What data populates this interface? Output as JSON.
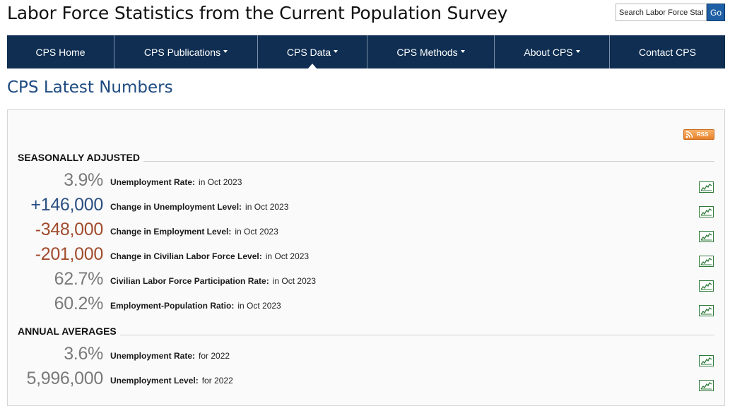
{
  "header": {
    "site_title": "Labor Force Statistics from the Current Population Survey",
    "search": {
      "value": "Search Labor Force Stat",
      "go_label": "Go"
    }
  },
  "nav": {
    "items": [
      {
        "label": "CPS Home"
      },
      {
        "label": "CPS Publications"
      },
      {
        "label": "CPS Data"
      },
      {
        "label": "CPS Methods"
      },
      {
        "label": "About CPS"
      },
      {
        "label": "Contact CPS"
      }
    ]
  },
  "page": {
    "heading": "CPS Latest Numbers"
  },
  "rss": {
    "label": "RSS",
    "icon": "rss-feed-icon"
  },
  "sections": [
    {
      "title": "SEASONALLY ADJUSTED",
      "rows": [
        {
          "value": "3.9%",
          "label": "Unemployment Rate:",
          "period": "in Oct 2023",
          "tone": "neutral"
        },
        {
          "value": "+146,000",
          "label": "Change in Unemployment Level:",
          "period": "in Oct 2023",
          "tone": "pos"
        },
        {
          "value": "-348,000",
          "label": "Change in Employment Level:",
          "period": "in Oct 2023",
          "tone": "neg"
        },
        {
          "value": "-201,000",
          "label": "Change in Civilian Labor Force Level:",
          "period": "in Oct 2023",
          "tone": "neg"
        },
        {
          "value": "62.7%",
          "label": "Civilian Labor Force Participation Rate:",
          "period": "in Oct 2023",
          "tone": "neutral"
        },
        {
          "value": "60.2%",
          "label": "Employment-Population Ratio:",
          "period": "in Oct 2023",
          "tone": "neutral"
        }
      ]
    },
    {
      "title": "ANNUAL AVERAGES",
      "rows": [
        {
          "value": "3.6%",
          "label": "Unemployment Rate:",
          "period": "for 2022",
          "tone": "neutral"
        },
        {
          "value": "5,996,000",
          "label": "Unemployment Level:",
          "period": "for 2022",
          "tone": "neutral"
        }
      ]
    }
  ],
  "colors": {
    "nav_bg": "#0f2e52",
    "heading": "#1d4a80",
    "positive": "#2b4f82",
    "negative": "#a14c2d",
    "neutral": "#7a7a7a",
    "chart_icon": "#2e7a3a"
  },
  "icons": {
    "chart": "line-chart-icon",
    "caret": "caret-down-icon"
  }
}
